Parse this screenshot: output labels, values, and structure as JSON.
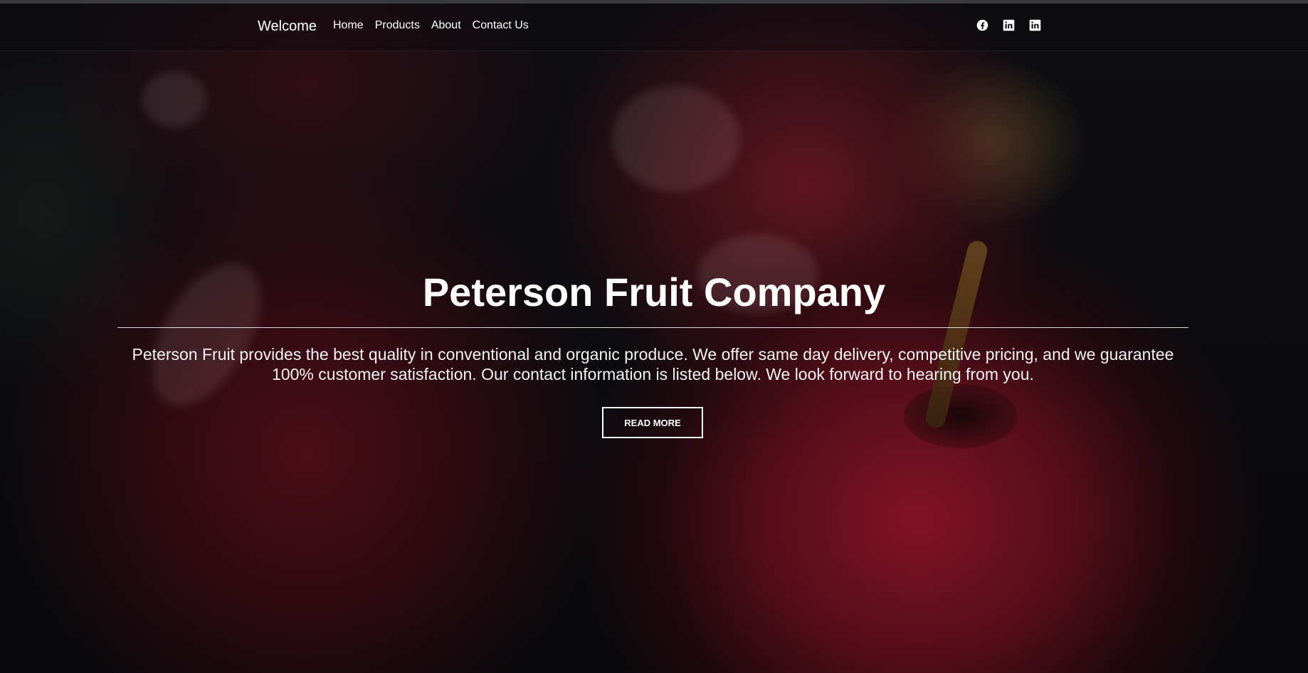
{
  "navbar": {
    "brand": "Welcome",
    "links": [
      {
        "label": "Home"
      },
      {
        "label": "Products"
      },
      {
        "label": "About"
      },
      {
        "label": "Contact Us"
      }
    ],
    "social_icons": [
      "facebook-icon",
      "linkedin-icon",
      "linkedin-icon"
    ]
  },
  "hero": {
    "title": "Peterson Fruit Company",
    "description": "Peterson Fruit provides the best quality in conventional and organic produce. We offer same day delivery, competitive pricing, and we guarantee 100% customer satisfaction. Our contact information is listed below. We look forward to hearing from you.",
    "button_label": "READ MORE"
  },
  "colors": {
    "text": "#ffffff",
    "background": "#0b0b0d",
    "accent_apple_red": "#8c1428"
  }
}
